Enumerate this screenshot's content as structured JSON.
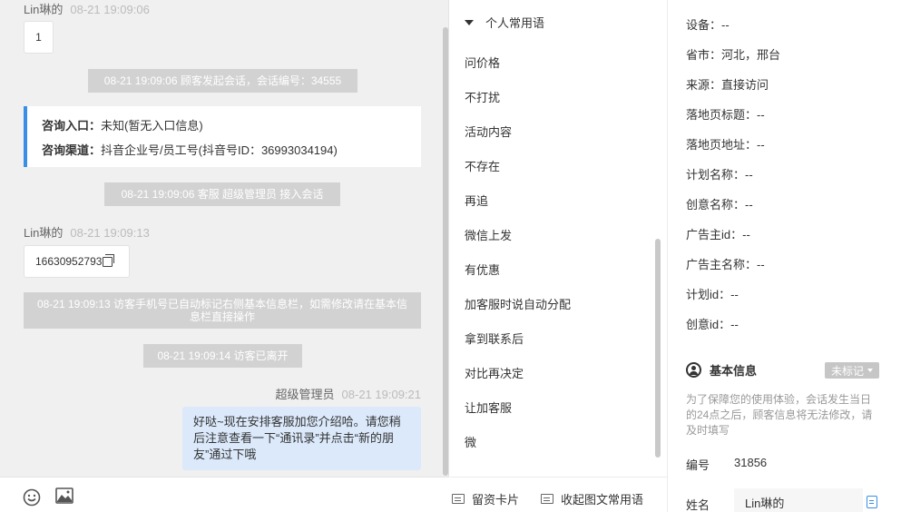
{
  "chat": {
    "messages": {
      "m1_sender": "Lin琳的",
      "m1_time": "08-21 19:09:06",
      "m1_text": "1",
      "sys1": "08-21 19:09:06 顾客发起会话，会话编号：34555",
      "card_entry_label": "咨询入口：",
      "card_entry_value": "未知(暂无入口信息)",
      "card_channel_label": "咨询渠道：",
      "card_channel_value": "抖音企业号/员工号(抖音号ID：36993034194)",
      "sys2": "08-21 19:09:06 客服 超级管理员 接入会话",
      "m2_sender": "Lin琳的",
      "m2_time": "08-21 19:09:13",
      "m2_text": "16630952793",
      "sys3": "08-21 19:09:13 访客手机号已自动标记右侧基本信息栏，如需修改请在基本信息栏直接操作",
      "sys4": "08-21 19:09:14 访客已离开",
      "m3_sender": "超级管理员",
      "m3_time": "08-21 19:09:21",
      "m3_text": "好哒~现在安排客服加您介绍哈。请您稍后注意查看一下“通讯录”并点击“新的朋友”通过下哦"
    },
    "toolbar": {
      "emoji": "emoji-icon",
      "image": "image-icon"
    }
  },
  "phrases": {
    "header": "个人常用语",
    "items": [
      "问价格",
      "不打扰",
      "活动内容",
      "不存在",
      "再追",
      "微信上发",
      "有优惠",
      "加客服时说自动分配",
      "拿到联系后",
      "对比再决定",
      "让加客服",
      "微"
    ],
    "footer": {
      "card_label": "留资卡片",
      "collapse_label": "收起图文常用语"
    }
  },
  "info": {
    "rows": [
      "设备：--",
      "省市：河北，邢台",
      "来源：直接访问",
      "落地页标题：--",
      "落地页地址：--",
      "计划名称：--",
      "创意名称：--",
      "广告主id：--",
      "广告主名称：--",
      "计划id：--",
      "创意id：--"
    ],
    "section_title": "基本信息",
    "tag_select": "未标记",
    "notice": "为了保障您的使用体验，会话发生当日的24点之后，顾客信息将无法修改，请及时填写",
    "id_label": "编号",
    "id_value": "31856",
    "name_label": "姓名",
    "name_value": "Lin琳的"
  }
}
